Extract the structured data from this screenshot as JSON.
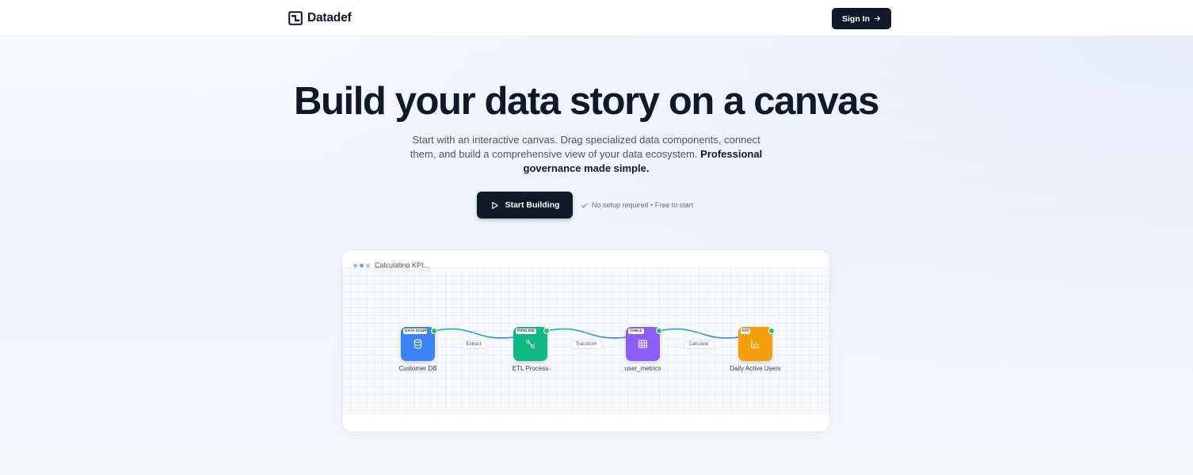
{
  "brand": {
    "name": "Datadef"
  },
  "header": {
    "signin_label": "Sign In"
  },
  "hero": {
    "title": "Build your data story on a canvas",
    "subtitle": "Start with an interactive canvas. Drag specialized data components, connect them, and build a comprehensive view of your data ecosystem.",
    "subtitle_emphasis": "Professional governance made simple.",
    "cta_label": "Start Building",
    "note": "No setup required • Free to start"
  },
  "canvas": {
    "status": "Calculating KPI...",
    "status_dot_colors": [
      "#7dd3c0",
      "#60a5fa",
      "#c4b5fd"
    ],
    "nodes": [
      {
        "tag": "DATA SOURCE",
        "label": "Customer DB",
        "color": "#3b82f6",
        "icon": "database-icon"
      },
      {
        "tag": "PIPELINE",
        "label": "ETL Process",
        "color": "#10b981",
        "icon": "pipeline-icon"
      },
      {
        "tag": "TABLE",
        "label": "user_metrics",
        "color": "#8b5cf6",
        "icon": "table-icon"
      },
      {
        "tag": "KPI",
        "label": "Daily Active Users",
        "color": "#f59e0b",
        "icon": "bar-chart-icon"
      }
    ],
    "edges": [
      {
        "label": "Extract"
      },
      {
        "label": "Transform"
      },
      {
        "label": "Calculate"
      }
    ],
    "edge_gradient": [
      "#14b8a6",
      "#3b82f6"
    ],
    "handle_color": "#22c55e"
  }
}
